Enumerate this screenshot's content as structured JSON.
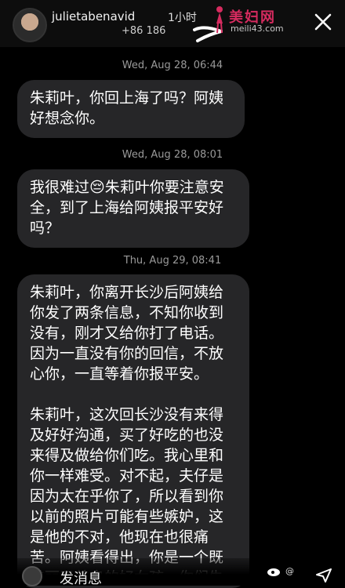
{
  "header": {
    "username": "julietabenavid",
    "time_ago": "1小时",
    "phone": "+86 186",
    "watermark_title": "美妇网",
    "watermark_url": "meili43.com"
  },
  "messages": [
    {
      "timestamp": "Wed, Aug 28, 06:44",
      "text": "朱莉叶，你回上海了吗？阿姨\n好想念你。"
    },
    {
      "timestamp": "Wed, Aug 28, 08:01",
      "text": "我很难过😔朱莉叶你要注意安\n全，到了上海给阿姨报平安好\n吗？"
    },
    {
      "timestamp": "Thu, Aug 29, 08:41",
      "text": "朱莉叶，你离开长沙后阿姨给\n你发了两条信息，不知你收到\n没有，刚才又给你打了电话。\n因为一直没有你的回信，不放\n心你，一直等着你报平安。\n\n朱莉叶，这次回长沙没有来得\n及好好沟通，买了好吃的也没\n来得及做给你们吃。我心里和\n你一样难受。对不起，夫仔是\n因为太在乎你了，所以看到你\n以前的照片可能有些嫉妒，这\n是他的不对，他现在也很痛\n苦。阿姨看得出，你是一个既\n美丽又善良的好女孩，你们失\n之交臂真的很遗憾，我们很惋"
    }
  ],
  "footer": {
    "input_placeholder": "发消息",
    "weibo_handle": "@"
  },
  "colors": {
    "background": "#000000",
    "bubble": "#262628",
    "timestamp": "#9a9a9a",
    "watermark": "#d62b5f"
  },
  "icons": [
    "close-icon",
    "camera-icon",
    "share-icon",
    "weibo-icon"
  ]
}
